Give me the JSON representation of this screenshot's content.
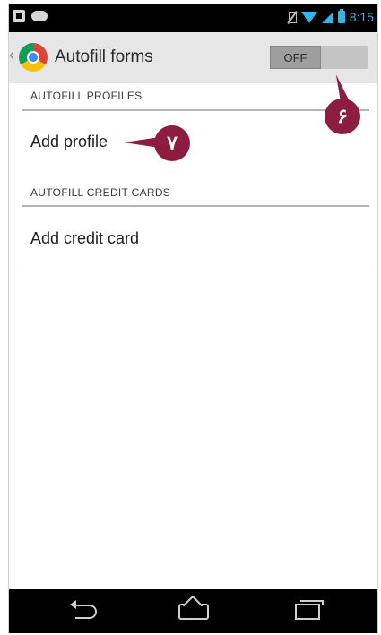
{
  "status_bar": {
    "time": "8:15",
    "icons": [
      "notification-icon",
      "game-controller-icon",
      "no-sim-icon",
      "wifi-icon",
      "signal-icon",
      "battery-icon"
    ]
  },
  "action_bar": {
    "title": "Autofill forms",
    "toggle_label": "OFF",
    "toggle_state": "off"
  },
  "sections": [
    {
      "header": "AUTOFILL PROFILES",
      "item": "Add profile"
    },
    {
      "header": "AUTOFILL CREDIT CARDS",
      "item": "Add credit card"
    }
  ],
  "callouts": [
    {
      "label": "۶"
    },
    {
      "label": "۷"
    }
  ],
  "colors": {
    "accent": "#33b5e5",
    "callout": "#8c1d40",
    "action_bar": "#e6e6e6"
  }
}
